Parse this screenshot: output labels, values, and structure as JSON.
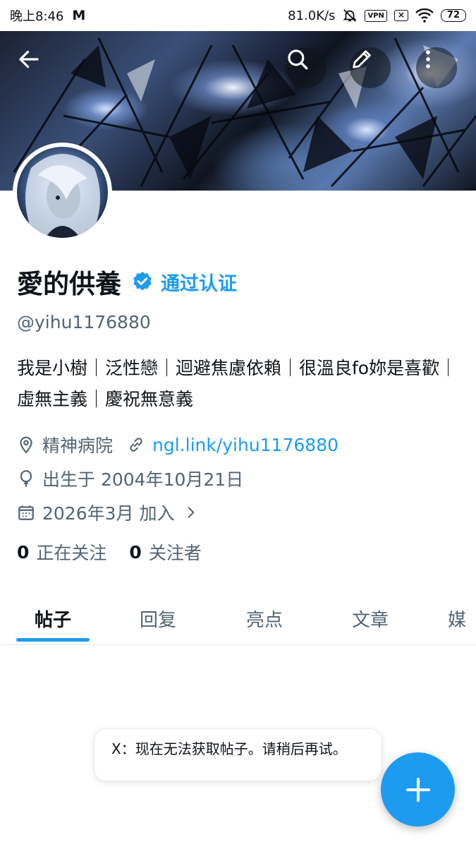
{
  "status_bar": {
    "time": "晚上8:46",
    "mail_glyph": "M",
    "speed": "81.0K/s",
    "vpn": "VPN",
    "battery": "72"
  },
  "header": {
    "back_icon": "arrow-left-icon",
    "search_icon": "search-icon",
    "edit_icon": "pencil-icon",
    "more_icon": "more-vertical-icon"
  },
  "profile": {
    "display_name": "愛的供養",
    "verify_label": "通过认证",
    "handle": "@yihu1176880",
    "bio": "我是小樹｜泛性戀｜迴避焦慮依賴｜很溫良fo妳是喜歡｜虛無主義｜慶祝無意義",
    "location": "精神病院",
    "website": "ngl.link/yihu1176880",
    "birthday": "出生于 2004年10月21日",
    "joined": "2026年3月 加入",
    "following_count": "0",
    "following_label": "正在关注",
    "followers_count": "0",
    "followers_label": "关注者"
  },
  "tabs": [
    {
      "label": "帖子",
      "active": true
    },
    {
      "label": "回复",
      "active": false
    },
    {
      "label": "亮点",
      "active": false
    },
    {
      "label": "文章",
      "active": false
    },
    {
      "label": "媒",
      "active": false
    }
  ],
  "toast": {
    "message": "X：现在无法获取帖子。请稍后再试。"
  },
  "fab": {
    "icon": "plus-icon"
  },
  "colors": {
    "accent": "#1d9bf0",
    "text_primary": "#0f1419",
    "text_secondary": "#536471"
  }
}
